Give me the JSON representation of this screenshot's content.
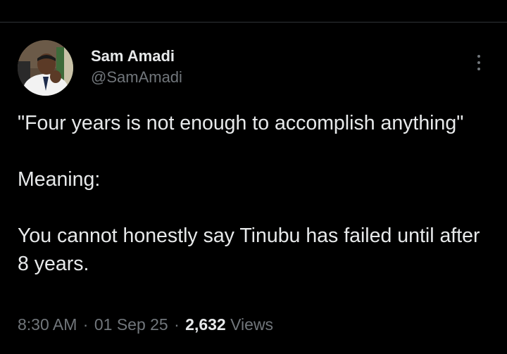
{
  "colors": {
    "background": "#000000",
    "text_primary": "#e7e9ea",
    "text_secondary": "#71767b",
    "divider": "#2f3336"
  },
  "author": {
    "display_name": "Sam Amadi",
    "handle": "@SamAmadi",
    "avatar_icon": "profile-photo"
  },
  "tweet": {
    "lines": [
      "\"Four years is not enough to accomplish anything\"",
      "Meaning:",
      "You cannot honestly say Tinubu has failed until after 8 years."
    ]
  },
  "meta": {
    "time": "8:30 AM",
    "date": "01 Sep 25",
    "separator": "·",
    "views_count": "2,632",
    "views_label": "Views"
  },
  "actions": {
    "more_icon": "more-vertical-icon"
  }
}
